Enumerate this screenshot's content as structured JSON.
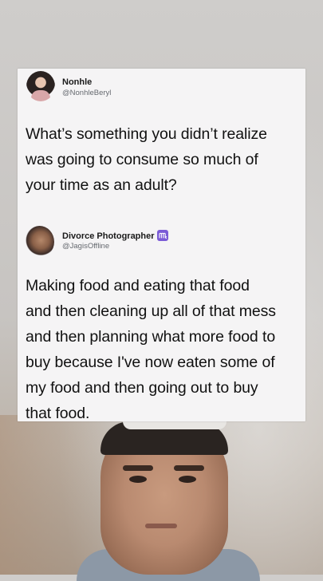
{
  "tweet1": {
    "name": "Nonhle",
    "handle": "@NonhleBeryl",
    "text_lines": [
      "What’s something you didn’t realize",
      "was going to consume so much of",
      "your time as an adult?"
    ],
    "avatar_icon": "user-avatar"
  },
  "tweet2": {
    "name": "Divorce Photographer",
    "handle": "@JagisOffline",
    "badge_icon": "scorpio-zodiac-icon",
    "text_lines": [
      "Making food and eating that food",
      "and then cleaning up all of that mess",
      "and then planning what more food to",
      "buy because I've now eaten some of",
      "my food and then going out to buy",
      "that food."
    ],
    "avatar_icon": "user-avatar"
  },
  "colors": {
    "card_bg": "#f5f4f5",
    "badge": "#7b5bd6",
    "text": "#111111",
    "handle": "#666a70"
  }
}
